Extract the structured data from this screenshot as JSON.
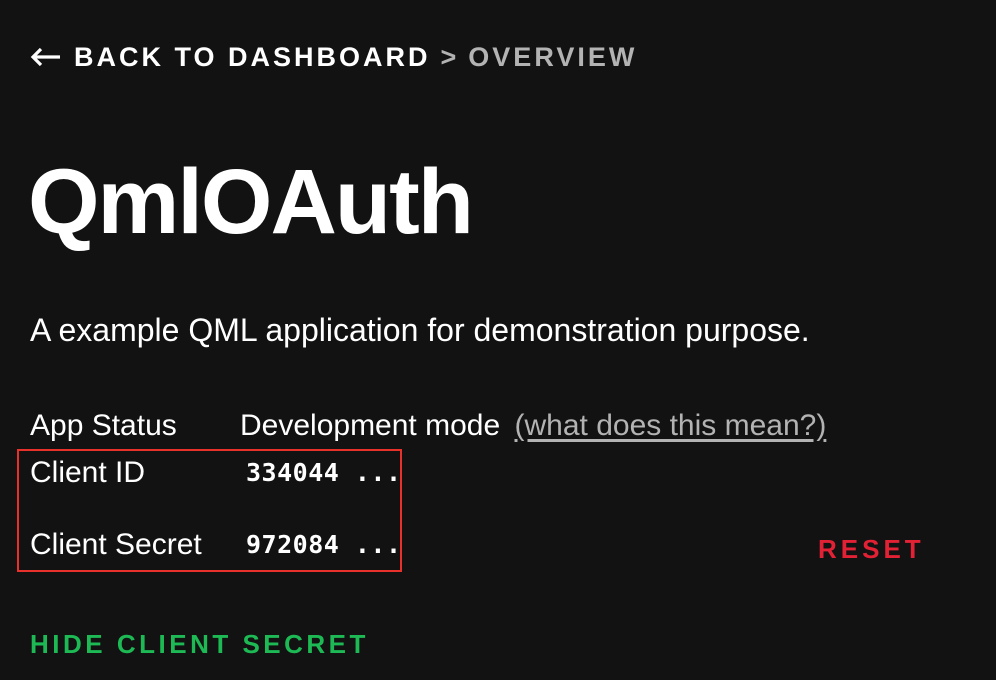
{
  "breadcrumb": {
    "back_label": "Back to Dashboard",
    "separator": ">",
    "current": "Overview",
    "back_icon": "arrow-left-icon"
  },
  "app": {
    "name": "QmlOAuth",
    "description": "A example QML application for demonstration purpose."
  },
  "details": {
    "status_label": "App Status",
    "status_value": "Development mode",
    "status_help_link": "(what does this mean?)",
    "client_id_label": "Client ID",
    "client_id_value": "334044 ...",
    "client_secret_label": "Client Secret",
    "client_secret_value": "972084 ..."
  },
  "actions": {
    "reset_label": "Reset",
    "hide_secret_label": "Hide client secret"
  },
  "colors": {
    "background": "#121212",
    "text": "#ffffff",
    "muted": "#b3b3b3",
    "reset": "#e22134",
    "accent_green": "#1db954",
    "highlight_border": "#e8312b"
  }
}
